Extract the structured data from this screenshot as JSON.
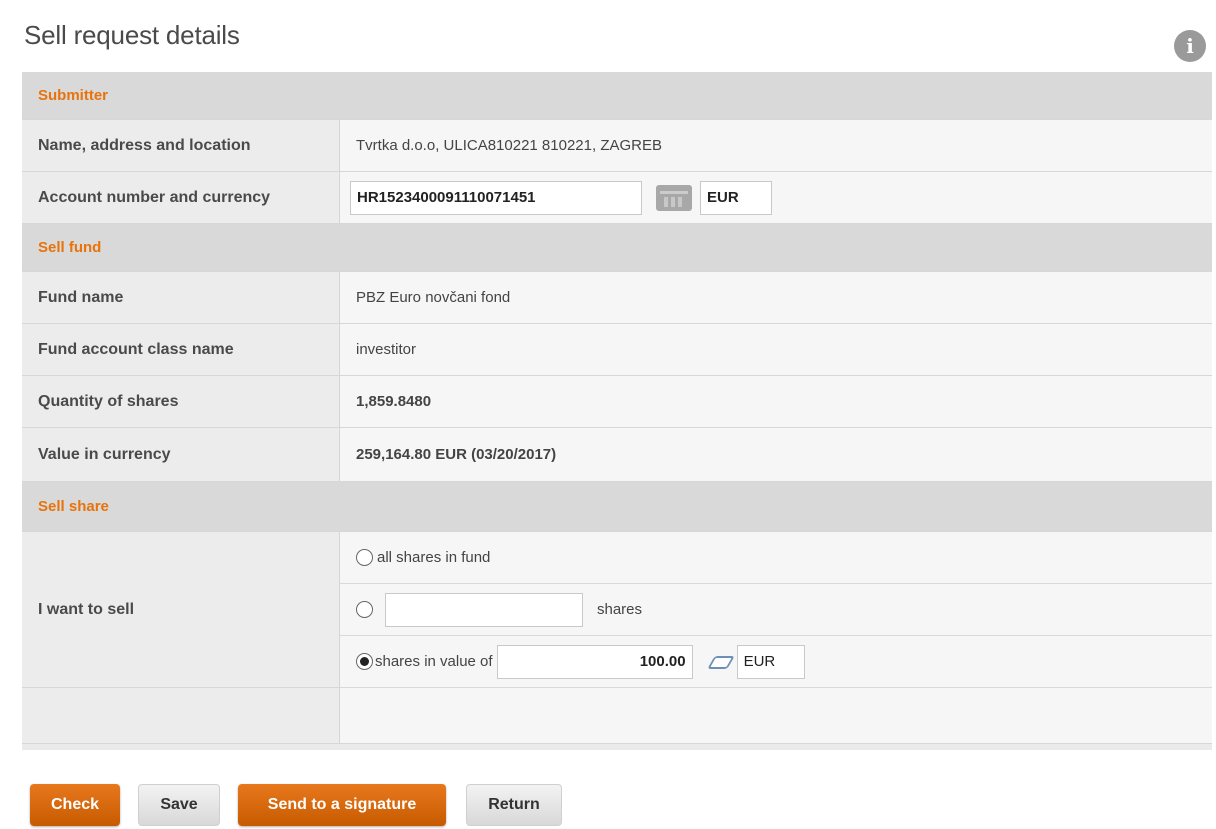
{
  "page": {
    "title": "Sell request details"
  },
  "sections": {
    "submitter": "Submitter",
    "sell_fund": "Sell fund",
    "sell_share": "Sell share"
  },
  "submitter": {
    "name_label": "Name, address and location",
    "name_value": "Tvrtka d.o.o, ULICA810221 810221, ZAGREB",
    "account_label": "Account number and currency",
    "account_value": "HR1523400091110071451",
    "currency_value": "EUR"
  },
  "fund": {
    "name_label": "Fund name",
    "name_value": "PBZ Euro novčani fond",
    "class_label": "Fund account class name",
    "class_value": "investitor",
    "quantity_label": "Quantity of shares",
    "quantity_value": "1,859.8480",
    "value_label": "Value in currency",
    "value_value": "259,164.80 EUR (03/20/2017)"
  },
  "sell": {
    "label": "I want to sell",
    "option_all": "all shares in fund",
    "option_shares_unit": "shares",
    "option_shares_value": "",
    "option_value": "shares in value of",
    "amount": "100.00",
    "amount_currency": "EUR",
    "selected_option": "value"
  },
  "buttons": {
    "check": "Check",
    "save": "Save",
    "send": "Send to a signature",
    "return": "Return"
  },
  "colors": {
    "accent": "#e8730c",
    "primary_button": "#d96a0a",
    "section_bg": "#d9d9d9"
  },
  "icons": [
    "info-icon",
    "calendar-icon",
    "eraser-icon",
    "radio-icon"
  ]
}
